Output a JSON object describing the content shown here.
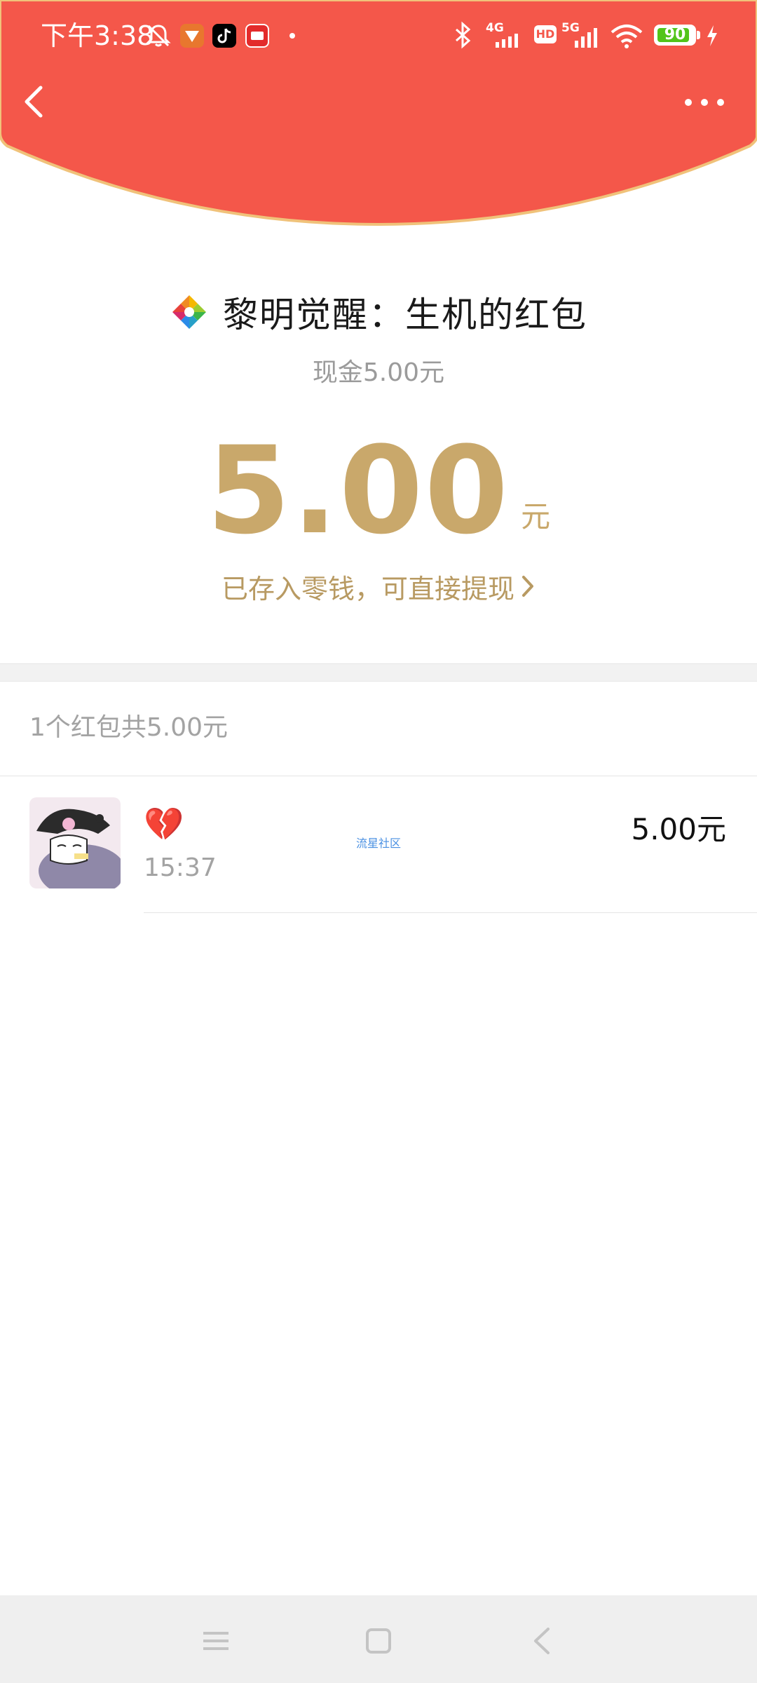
{
  "status_bar": {
    "time": "下午3:38",
    "network_1": "4G",
    "hd_label": "HD",
    "network_2": "5G",
    "battery_level": "90",
    "battery_fraction": 0.9,
    "battery_color": "#52c41a",
    "icons": [
      "mute-bell-icon",
      "app-badge-1",
      "tiktok-icon",
      "app-badge-3",
      "bluetooth-icon",
      "signal-icon",
      "wifi-icon",
      "charging-icon"
    ]
  },
  "header": {
    "background": "#f4574a",
    "border_color": "#f0c27a",
    "back_icon": "back-chevron-icon",
    "more_icon": "more-dots-icon"
  },
  "packet": {
    "title": "黎明觉醒：生机的红包",
    "subtitle": "现金5.00元",
    "amount": "5.00",
    "unit": "元",
    "deposit_text": "已存入零钱，可直接提现",
    "deposit_chevron": "›",
    "accent": "#c9a86b"
  },
  "summary": {
    "text": "1个红包共5.00元"
  },
  "records": [
    {
      "emoji": "💔",
      "time": "15:37",
      "amount": "5.00元",
      "watermark": "流星社区"
    }
  ],
  "nav": {
    "icons": [
      "menu-icon",
      "home-square-icon",
      "back-triangle-icon"
    ]
  }
}
